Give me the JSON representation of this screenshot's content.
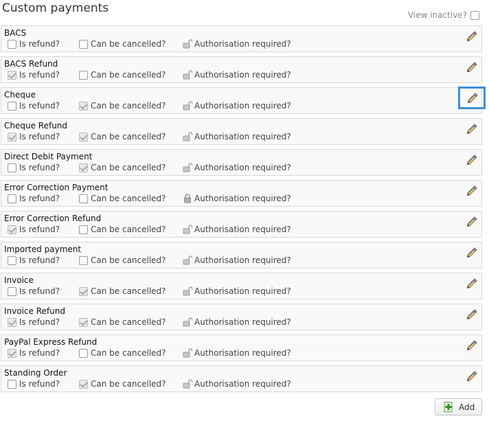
{
  "page_title": "Custom payments",
  "view_inactive_label": "View inactive?",
  "labels": {
    "is_refund": "Is refund?",
    "can_be_cancelled": "Can be cancelled?",
    "authorisation_required": "Authorisation required?"
  },
  "add_label": "Add",
  "payments": [
    {
      "name": "BACS",
      "is_refund": false,
      "can_be_cancelled": false,
      "auth_locked": false
    },
    {
      "name": "BACS Refund",
      "is_refund": true,
      "can_be_cancelled": false,
      "auth_locked": false
    },
    {
      "name": "Cheque",
      "is_refund": false,
      "can_be_cancelled": true,
      "auth_locked": false
    },
    {
      "name": "Cheque Refund",
      "is_refund": true,
      "can_be_cancelled": true,
      "auth_locked": false
    },
    {
      "name": "Direct Debit Payment",
      "is_refund": false,
      "can_be_cancelled": true,
      "auth_locked": false
    },
    {
      "name": "Error Correction Payment",
      "is_refund": false,
      "can_be_cancelled": false,
      "auth_locked": true
    },
    {
      "name": "Error Correction Refund",
      "is_refund": true,
      "can_be_cancelled": false,
      "auth_locked": false
    },
    {
      "name": "Imported payment",
      "is_refund": false,
      "can_be_cancelled": false,
      "auth_locked": false
    },
    {
      "name": "Invoice",
      "is_refund": false,
      "can_be_cancelled": true,
      "auth_locked": false
    },
    {
      "name": "Invoice Refund",
      "is_refund": true,
      "can_be_cancelled": true,
      "auth_locked": false
    },
    {
      "name": "PayPal Express Refund",
      "is_refund": true,
      "can_be_cancelled": false,
      "auth_locked": false
    },
    {
      "name": "Standing Order",
      "is_refund": false,
      "can_be_cancelled": true,
      "auth_locked": false
    }
  ],
  "focused_edit_index": 2
}
